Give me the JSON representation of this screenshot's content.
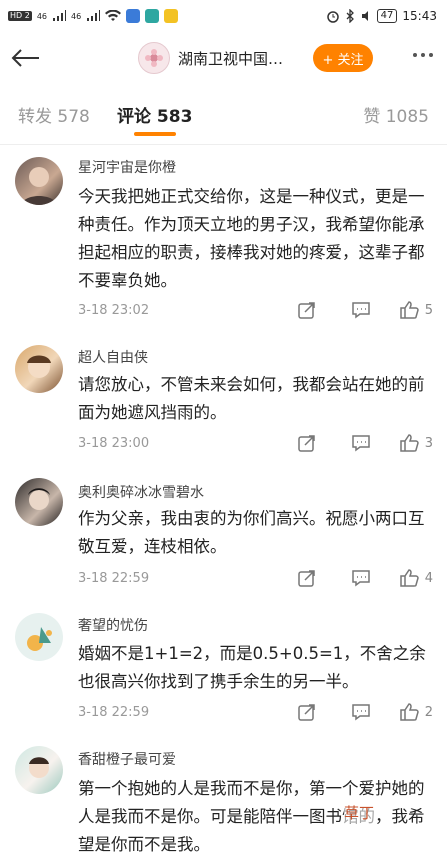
{
  "status_bar": {
    "left": [
      "HD 2",
      "46",
      "HD 1",
      "46"
    ],
    "battery": "47",
    "time": "15:43"
  },
  "header": {
    "title": "湖南卫视中国…",
    "follow_label": "+ 关注"
  },
  "tabs": {
    "repost": "转发 578",
    "comment": "评论 583",
    "like": "赞 1085"
  },
  "comments": [
    {
      "user": "星河宇宙是你橙",
      "text": "今天我把她正式交给你，这是一种仪式，更是一种责任。作为顶天立地的男子汉，我希望你能承担起相应的职责，接棒我对她的疼爱，这辈子都不要辜负她。",
      "time": "3-18 23:02",
      "likes": "5"
    },
    {
      "user": "超人自由侠",
      "text": "请您放心，不管未来会如何，我都会站在她的前面为她遮风挡雨的。",
      "time": "3-18 23:00",
      "likes": "3"
    },
    {
      "user": "奥利奥碎冰冰雪碧水",
      "text": "作为父亲，我由衷的为你们高兴。祝愿小两口互敬互爱，连枝相依。",
      "time": "3-18 22:59",
      "likes": "4"
    },
    {
      "user": "奢望的忧伤",
      "text": "婚姻不是1+1=2，而是0.5+0.5=1，不舍之余也很高兴你找到了携手余生的另一半。",
      "time": "3-18 22:59",
      "likes": "2"
    },
    {
      "user": "香甜橙子最可爱",
      "text": "第一个抱她的人是我而不是你，第一个爱护她的人是我而不是你。可是能陪伴一图书馆的，我希望是你而不是我。",
      "time": "",
      "likes": ""
    }
  ],
  "watermark": "草丁",
  "colors": {
    "accent": "#ff8200",
    "text": "#222222",
    "muted": "#999999"
  }
}
